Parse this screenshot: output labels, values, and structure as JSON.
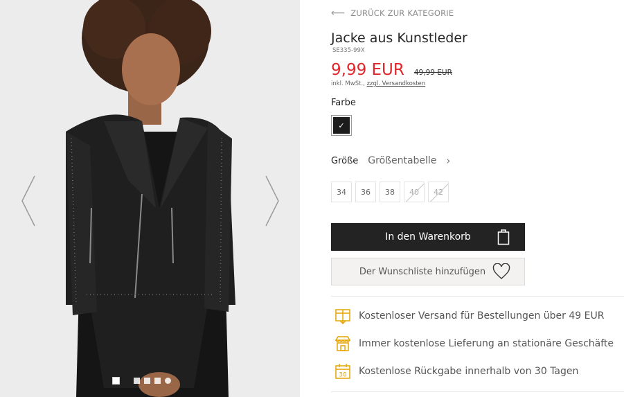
{
  "gallery": {
    "icons": {
      "prev": "chevron-left-icon",
      "next": "chevron-right-icon"
    },
    "dot_count": 6,
    "active_dot": 1
  },
  "product": {
    "back_label": "ZURÜCK ZUR KATEGORIE",
    "title": "Jacke aus Kunstleder",
    "sku": "SE335-99X",
    "price": "9,99 EUR",
    "old_price": "49,99 EUR",
    "vat_prefix": "inkl. MwSt.,",
    "shipping_link": "zzgl. Versandkosten",
    "price_color": "#e0262b"
  },
  "color": {
    "label": "Farbe",
    "selected_hex": "#1c1c1c"
  },
  "size": {
    "label": "Größe",
    "table_link": "Größentabelle",
    "options": [
      {
        "label": "34",
        "available": true
      },
      {
        "label": "36",
        "available": true
      },
      {
        "label": "38",
        "available": true
      },
      {
        "label": "40",
        "available": false
      },
      {
        "label": "42",
        "available": false
      }
    ]
  },
  "actions": {
    "cart_label": "In den Warenkorb",
    "wishlist_label": "Der Wunschliste hinzufügen",
    "cart_color": "#232323"
  },
  "benefits": [
    {
      "icon": "shipping-box-icon",
      "text": "Kostenloser Versand für Bestellungen über 49 EUR"
    },
    {
      "icon": "store-icon",
      "text": "Immer kostenlose Lieferung an stationäre Geschäfte"
    },
    {
      "icon": "calendar-30-icon",
      "text": "Kostenlose Rückgabe innerhalb von 30 Tagen"
    }
  ],
  "accent_color": "#e6a400"
}
